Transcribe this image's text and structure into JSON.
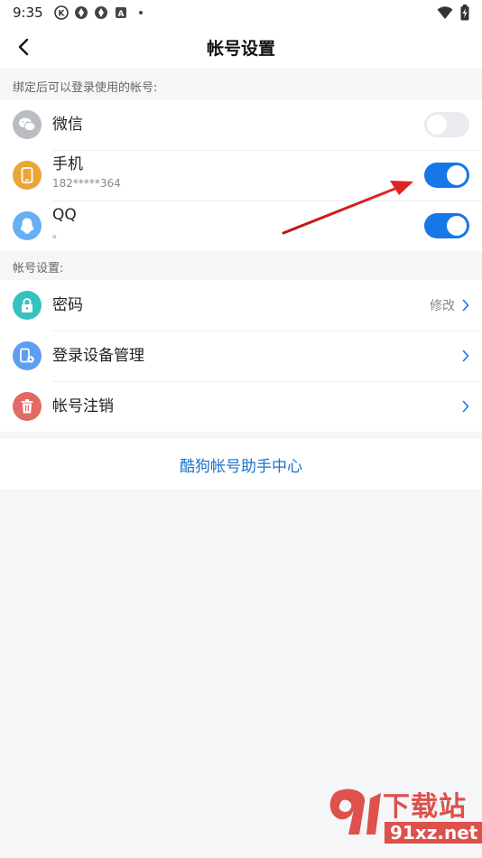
{
  "status_bar": {
    "time": "9:35",
    "icons": [
      "k-circle-icon",
      "aperture-icon",
      "aperture-icon",
      "a-box-icon",
      "dot-icon"
    ],
    "right_icons": [
      "wifi-icon",
      "battery-charging-icon"
    ]
  },
  "header": {
    "title": "帐号设置"
  },
  "bound_section": {
    "label": "绑定后可以登录使用的帐号:",
    "items": [
      {
        "icon": "wechat-icon",
        "color": "#b9bcc1",
        "title": "微信",
        "subtitle": "",
        "enabled": false
      },
      {
        "icon": "phone-icon",
        "color": "#eba534",
        "title": "手机",
        "subtitle": "182*****364",
        "enabled": true
      },
      {
        "icon": "qq-icon",
        "color": "#67aef5",
        "title": "QQ",
        "subtitle": "。",
        "enabled": true
      }
    ]
  },
  "account_section": {
    "label": "帐号设置:",
    "items": [
      {
        "icon": "lock-icon",
        "color": "#36c2bf",
        "title": "密码",
        "action": "修改"
      },
      {
        "icon": "device-settings-icon",
        "color": "#5c9ef2",
        "title": "登录设备管理",
        "action": ""
      },
      {
        "icon": "trash-icon",
        "color": "#e26a64",
        "title": "帐号注销",
        "action": ""
      }
    ]
  },
  "help": {
    "label": "酷狗帐号助手中心"
  },
  "watermark": {
    "brand": "下载站",
    "site": "91xz.net"
  },
  "colors": {
    "accent": "#1677e8",
    "link": "#1a73c9",
    "annotation_arrow": "#d81e1e"
  }
}
